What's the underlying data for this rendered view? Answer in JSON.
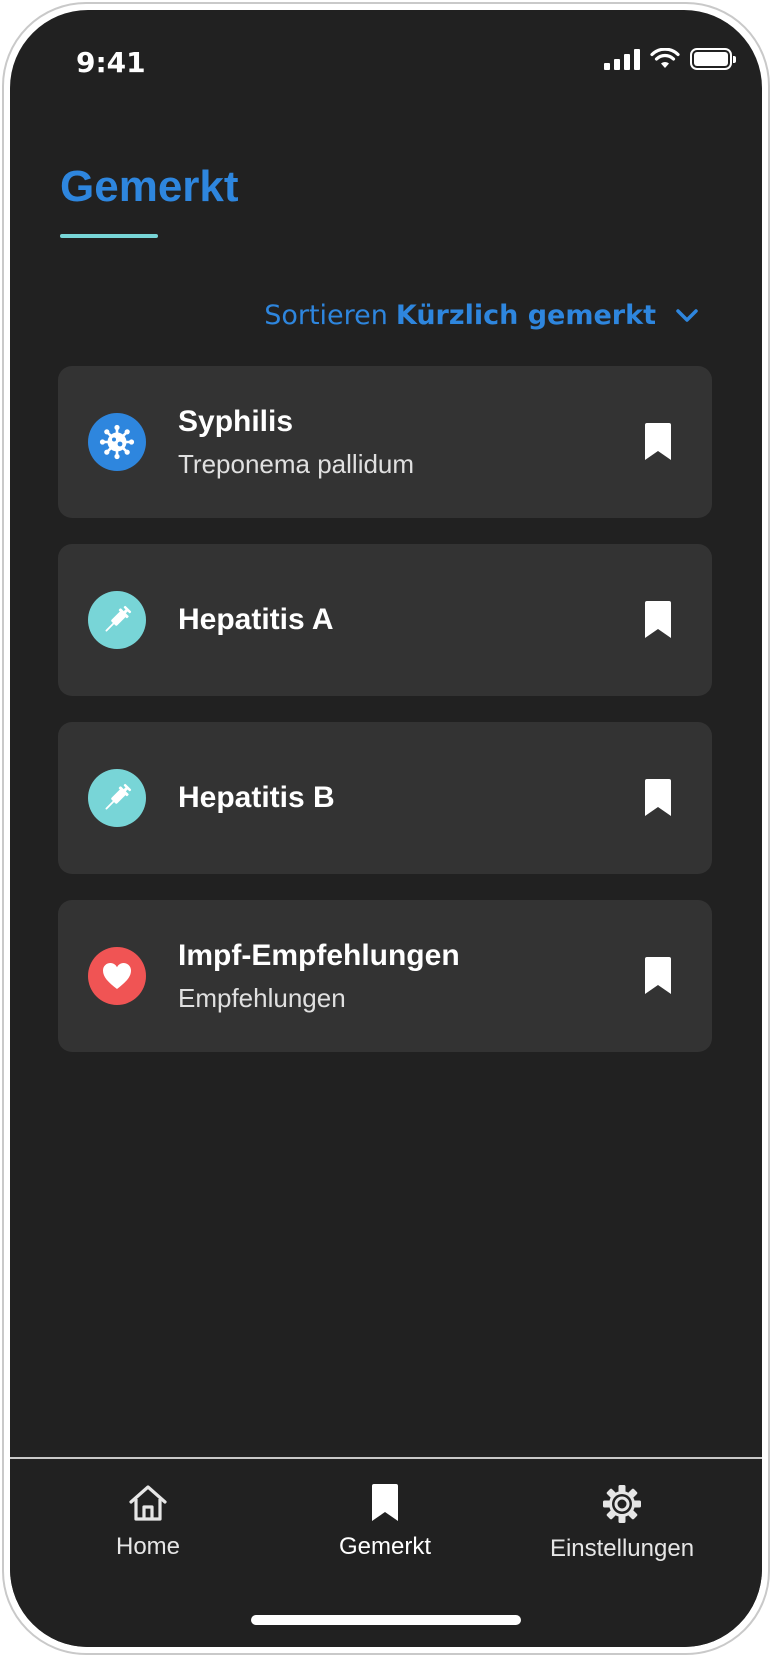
{
  "status_bar": {
    "time": "9:41"
  },
  "header": {
    "title": "Gemerkt"
  },
  "sort": {
    "label": "Sortieren",
    "value": "Kürzlich gemerkt"
  },
  "items": [
    {
      "title": "Syphilis",
      "subtitle": "Treponema pallidum",
      "icon": "virus-icon",
      "icon_color": "#2e86de"
    },
    {
      "title": "Hepatitis A",
      "subtitle": "",
      "icon": "syringe-icon",
      "icon_color": "#78d5d7"
    },
    {
      "title": "Hepatitis B",
      "subtitle": "",
      "icon": "syringe-icon",
      "icon_color": "#78d5d7"
    },
    {
      "title": "Impf-Empfehlungen",
      "subtitle": "Empfehlungen",
      "icon": "heart-icon",
      "icon_color": "#f05454"
    }
  ],
  "tabs": [
    {
      "label": "Home",
      "icon": "home-icon",
      "active": false
    },
    {
      "label": "Gemerkt",
      "icon": "bookmark-icon",
      "active": true
    },
    {
      "label": "Einstellungen",
      "icon": "gear-icon",
      "active": false
    }
  ],
  "colors": {
    "accent": "#2e86de",
    "teal": "#78d5d7",
    "red": "#f05454",
    "background": "#212121",
    "card": "#333333"
  }
}
